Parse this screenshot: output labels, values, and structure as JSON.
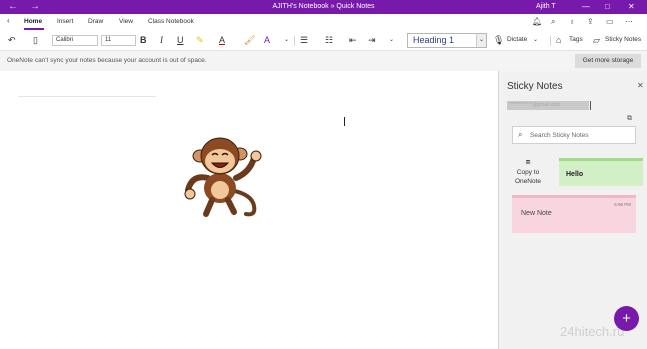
{
  "titlebar": {
    "back": "←",
    "forward": "→",
    "title": "AJITH's Notebook » Quick Notes",
    "user": "Ajith T",
    "minimize": "—",
    "maximize": "□",
    "close": "✕"
  },
  "tabs": [
    "Home",
    "Insert",
    "Draw",
    "View",
    "Class Notebook"
  ],
  "toolbar": {
    "font": "Calibri",
    "size": "11",
    "bold": "B",
    "italic": "I",
    "underline": "U",
    "style": "Heading 1",
    "dictate_label": "Dictate",
    "tags_label": "Tags",
    "sticky_label": "Sticky Notes"
  },
  "infobar": {
    "message": "OneNote can't sync your notes because your account is out of space.",
    "button": "Get more storage"
  },
  "sticky_panel": {
    "title": "Sticky Notes",
    "account": "************@gmail.com",
    "search_placeholder": "Search Sticky Notes",
    "copy_line1": "Copy to",
    "copy_line2": "OneNote",
    "notes": [
      {
        "text": "Hello",
        "time": "",
        "color": "#d3efc6"
      },
      {
        "text": "New Note",
        "time": "5:06 PM",
        "color": "#f9d6df"
      }
    ],
    "fab": "+"
  },
  "watermark": "24hitech.ru",
  "colors": {
    "accent": "#7719aa"
  }
}
